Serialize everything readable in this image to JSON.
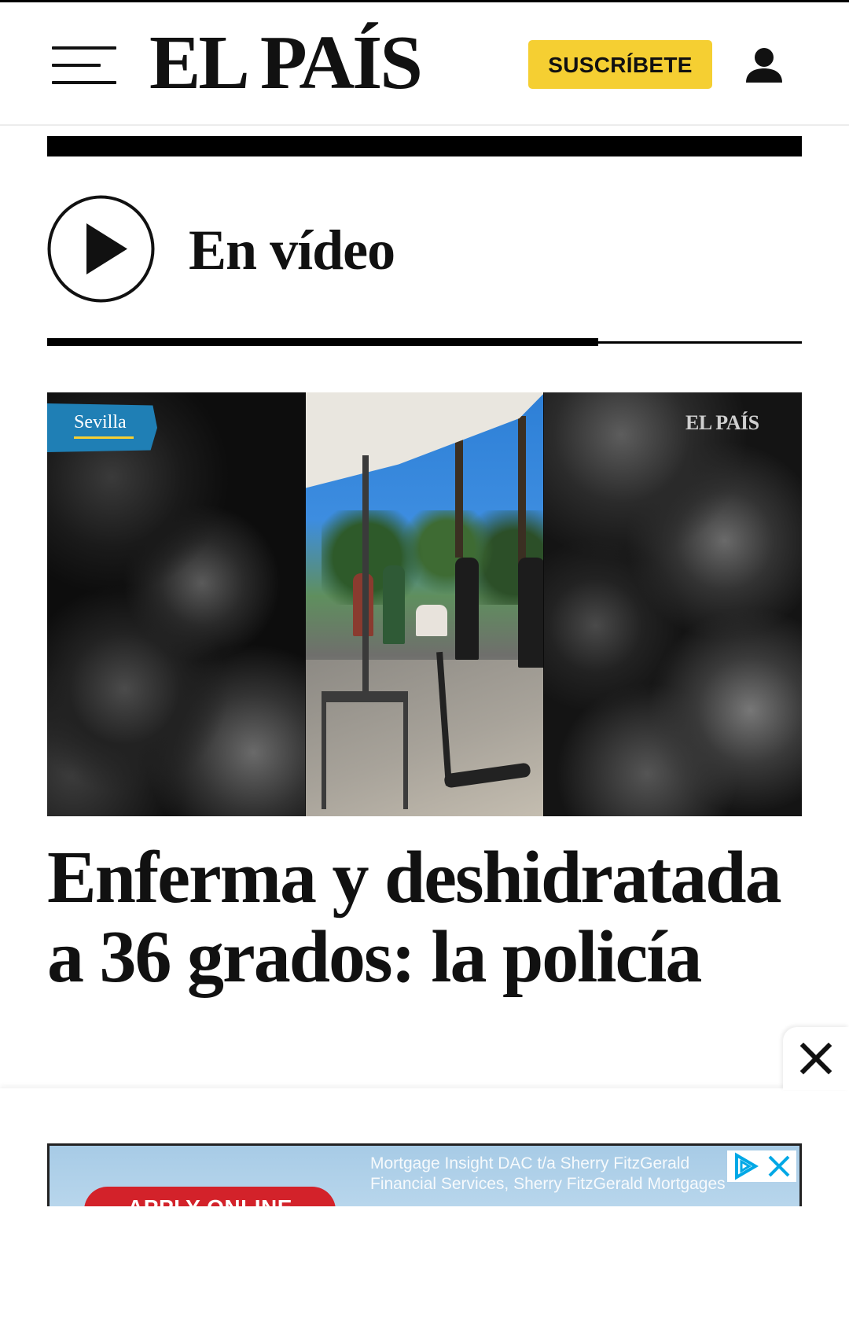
{
  "header": {
    "logo": "EL PAÍS",
    "subscribe_label": "SUSCRÍBETE",
    "menu_icon": "menu-icon",
    "user_icon": "user-icon"
  },
  "video_section": {
    "title": "En vídeo",
    "play_icon": "play-icon",
    "carousel_progress": 0.73
  },
  "video": {
    "tag": "Sevilla",
    "watermark": "EL PAÍS"
  },
  "article": {
    "headline": "Enferma y deshidratada a 36 grados: la policía"
  },
  "ad": {
    "apply_label": "APPLY ONLINE",
    "text_line1": "Mortgage Insight DAC t/a Sherry FitzGerald",
    "text_line2": "Financial Services, Sherry FitzGerald Mortgages",
    "close_icon": "close-icon",
    "adchoices_icon": "adchoices-icon"
  },
  "colors": {
    "brand_yellow": "#f5cf32",
    "tag_blue": "#1f7fb5",
    "ad_red": "#d3222a",
    "text": "#111111"
  }
}
